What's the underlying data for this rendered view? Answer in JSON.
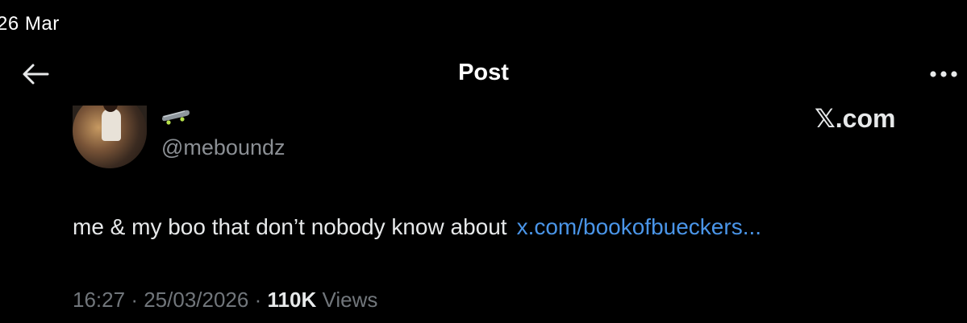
{
  "status_bar": {
    "date": "26 Mar"
  },
  "header": {
    "title": "Post",
    "back_icon": "arrow-left-icon",
    "more_icon": "ellipsis-icon"
  },
  "author": {
    "display_name_icon": "skateboard-emoji",
    "handle": "@meboundz"
  },
  "watermark": "𝕏.com",
  "post": {
    "text": "me & my boo that don’t nobody know about",
    "link": "x.com/bookofbueckers..."
  },
  "meta": {
    "time": "16:27",
    "separator": "·",
    "date": "25/03/2026",
    "views_count": "110K",
    "views_label": "Views"
  },
  "colors": {
    "background": "#000000",
    "link": "#4a95e8",
    "muted": "#71767b"
  }
}
